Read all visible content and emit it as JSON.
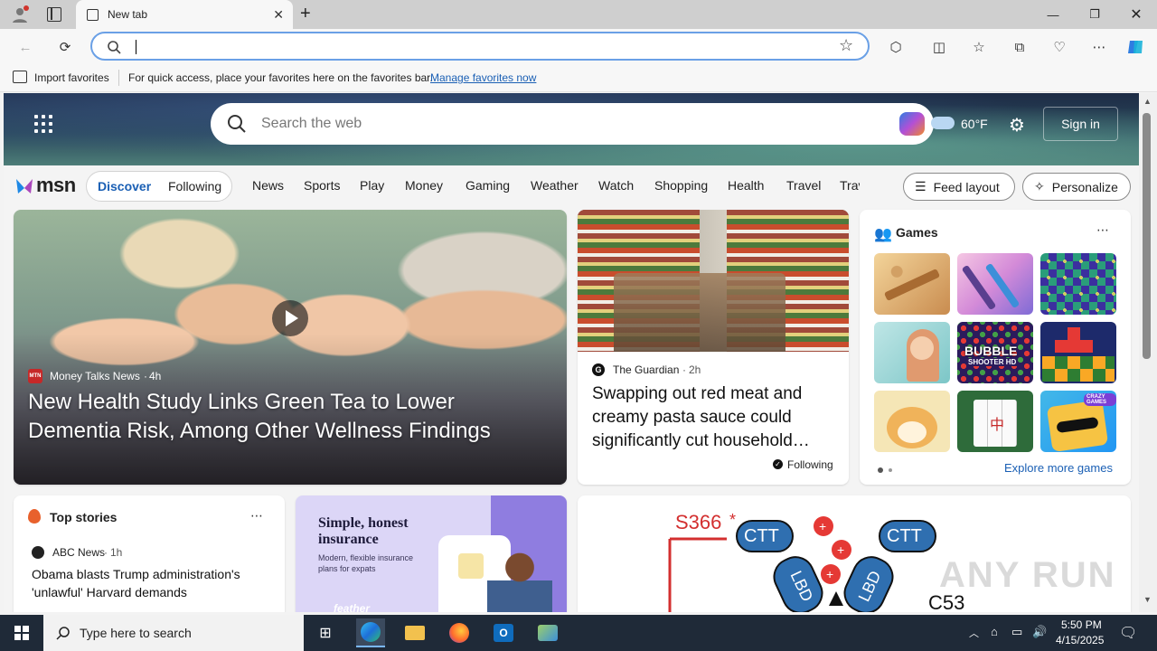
{
  "browser": {
    "tab_title": "New tab",
    "address_value": "",
    "colors": {
      "accent": "#1a5fb4",
      "address_border": "#6aa0e6"
    }
  },
  "favorites_bar": {
    "import_label": "Import favorites",
    "message": "For quick access, place your favorites here on the favorites bar.",
    "manage_link": "Manage favorites now"
  },
  "msn": {
    "search_placeholder": "Search the web",
    "temperature": "60°F",
    "sign_in": "Sign in",
    "logo_text": "msn",
    "tabs": [
      "Discover",
      "Following"
    ],
    "nav": [
      "News",
      "Sports",
      "Play",
      "Money",
      "Gaming",
      "Weather",
      "Watch",
      "Shopping",
      "Health",
      "Travel",
      "Trav"
    ],
    "feed_layout": "Feed layout",
    "personalize": "Personalize"
  },
  "hero_story": {
    "source": "Money Talks News",
    "age": "4h",
    "source_badge": "MTN",
    "headline": "New Health Study Links Green Tea to Lower Dementia Risk, Among Other Wellness Findings"
  },
  "guardian_story": {
    "source": "The Guardian",
    "age": "2h",
    "headline": "Swapping out red meat and creamy pasta sauce could significantly cut household…",
    "following": "Following"
  },
  "games_card": {
    "title": "Games",
    "explore": "Explore more games",
    "bubble_shooter": [
      "BUBBLE",
      "SHOOTER HD"
    ],
    "crazy_games_badge": "CRAZY GAMES"
  },
  "top_stories": {
    "title": "Top stories",
    "source": "ABC News",
    "age": "1h",
    "headline": "Obama blasts Trump administration's 'unlawful' Harvard demands"
  },
  "insurance_ad": {
    "title": "Simple, honest insurance",
    "subtitle": "Modern, flexible insurance plans for expats",
    "brand": "feather"
  },
  "diagram_card": {
    "label_top": "S366",
    "star": "*",
    "bubble_left": "CTT",
    "bubble_right": "CTT",
    "lbd_left": "LBD",
    "lbd_right": "LBD",
    "label_bottom": "C53",
    "watermark": "ANY RUN"
  },
  "taskbar": {
    "search_placeholder": "Type here to search",
    "time": "5:50 PM",
    "date": "4/15/2025"
  }
}
